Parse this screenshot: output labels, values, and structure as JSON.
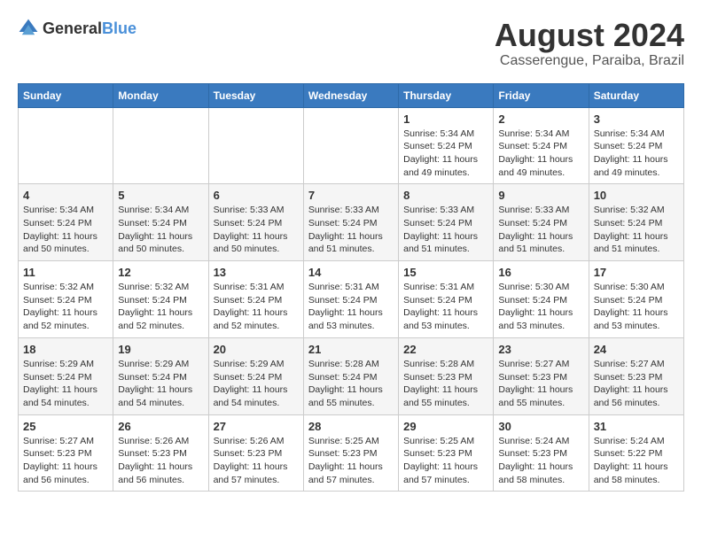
{
  "logo": {
    "text_general": "General",
    "text_blue": "Blue"
  },
  "title": "August 2024",
  "subtitle": "Casserengue, Paraiba, Brazil",
  "days_of_week": [
    "Sunday",
    "Monday",
    "Tuesday",
    "Wednesday",
    "Thursday",
    "Friday",
    "Saturday"
  ],
  "weeks": [
    [
      {
        "day": "",
        "info": ""
      },
      {
        "day": "",
        "info": ""
      },
      {
        "day": "",
        "info": ""
      },
      {
        "day": "",
        "info": ""
      },
      {
        "day": "1",
        "info": "Sunrise: 5:34 AM\nSunset: 5:24 PM\nDaylight: 11 hours and 49 minutes."
      },
      {
        "day": "2",
        "info": "Sunrise: 5:34 AM\nSunset: 5:24 PM\nDaylight: 11 hours and 49 minutes."
      },
      {
        "day": "3",
        "info": "Sunrise: 5:34 AM\nSunset: 5:24 PM\nDaylight: 11 hours and 49 minutes."
      }
    ],
    [
      {
        "day": "4",
        "info": "Sunrise: 5:34 AM\nSunset: 5:24 PM\nDaylight: 11 hours and 50 minutes."
      },
      {
        "day": "5",
        "info": "Sunrise: 5:34 AM\nSunset: 5:24 PM\nDaylight: 11 hours and 50 minutes."
      },
      {
        "day": "6",
        "info": "Sunrise: 5:33 AM\nSunset: 5:24 PM\nDaylight: 11 hours and 50 minutes."
      },
      {
        "day": "7",
        "info": "Sunrise: 5:33 AM\nSunset: 5:24 PM\nDaylight: 11 hours and 51 minutes."
      },
      {
        "day": "8",
        "info": "Sunrise: 5:33 AM\nSunset: 5:24 PM\nDaylight: 11 hours and 51 minutes."
      },
      {
        "day": "9",
        "info": "Sunrise: 5:33 AM\nSunset: 5:24 PM\nDaylight: 11 hours and 51 minutes."
      },
      {
        "day": "10",
        "info": "Sunrise: 5:32 AM\nSunset: 5:24 PM\nDaylight: 11 hours and 51 minutes."
      }
    ],
    [
      {
        "day": "11",
        "info": "Sunrise: 5:32 AM\nSunset: 5:24 PM\nDaylight: 11 hours and 52 minutes."
      },
      {
        "day": "12",
        "info": "Sunrise: 5:32 AM\nSunset: 5:24 PM\nDaylight: 11 hours and 52 minutes."
      },
      {
        "day": "13",
        "info": "Sunrise: 5:31 AM\nSunset: 5:24 PM\nDaylight: 11 hours and 52 minutes."
      },
      {
        "day": "14",
        "info": "Sunrise: 5:31 AM\nSunset: 5:24 PM\nDaylight: 11 hours and 53 minutes."
      },
      {
        "day": "15",
        "info": "Sunrise: 5:31 AM\nSunset: 5:24 PM\nDaylight: 11 hours and 53 minutes."
      },
      {
        "day": "16",
        "info": "Sunrise: 5:30 AM\nSunset: 5:24 PM\nDaylight: 11 hours and 53 minutes."
      },
      {
        "day": "17",
        "info": "Sunrise: 5:30 AM\nSunset: 5:24 PM\nDaylight: 11 hours and 53 minutes."
      }
    ],
    [
      {
        "day": "18",
        "info": "Sunrise: 5:29 AM\nSunset: 5:24 PM\nDaylight: 11 hours and 54 minutes."
      },
      {
        "day": "19",
        "info": "Sunrise: 5:29 AM\nSunset: 5:24 PM\nDaylight: 11 hours and 54 minutes."
      },
      {
        "day": "20",
        "info": "Sunrise: 5:29 AM\nSunset: 5:24 PM\nDaylight: 11 hours and 54 minutes."
      },
      {
        "day": "21",
        "info": "Sunrise: 5:28 AM\nSunset: 5:24 PM\nDaylight: 11 hours and 55 minutes."
      },
      {
        "day": "22",
        "info": "Sunrise: 5:28 AM\nSunset: 5:23 PM\nDaylight: 11 hours and 55 minutes."
      },
      {
        "day": "23",
        "info": "Sunrise: 5:27 AM\nSunset: 5:23 PM\nDaylight: 11 hours and 55 minutes."
      },
      {
        "day": "24",
        "info": "Sunrise: 5:27 AM\nSunset: 5:23 PM\nDaylight: 11 hours and 56 minutes."
      }
    ],
    [
      {
        "day": "25",
        "info": "Sunrise: 5:27 AM\nSunset: 5:23 PM\nDaylight: 11 hours and 56 minutes."
      },
      {
        "day": "26",
        "info": "Sunrise: 5:26 AM\nSunset: 5:23 PM\nDaylight: 11 hours and 56 minutes."
      },
      {
        "day": "27",
        "info": "Sunrise: 5:26 AM\nSunset: 5:23 PM\nDaylight: 11 hours and 57 minutes."
      },
      {
        "day": "28",
        "info": "Sunrise: 5:25 AM\nSunset: 5:23 PM\nDaylight: 11 hours and 57 minutes."
      },
      {
        "day": "29",
        "info": "Sunrise: 5:25 AM\nSunset: 5:23 PM\nDaylight: 11 hours and 57 minutes."
      },
      {
        "day": "30",
        "info": "Sunrise: 5:24 AM\nSunset: 5:23 PM\nDaylight: 11 hours and 58 minutes."
      },
      {
        "day": "31",
        "info": "Sunrise: 5:24 AM\nSunset: 5:22 PM\nDaylight: 11 hours and 58 minutes."
      }
    ]
  ]
}
